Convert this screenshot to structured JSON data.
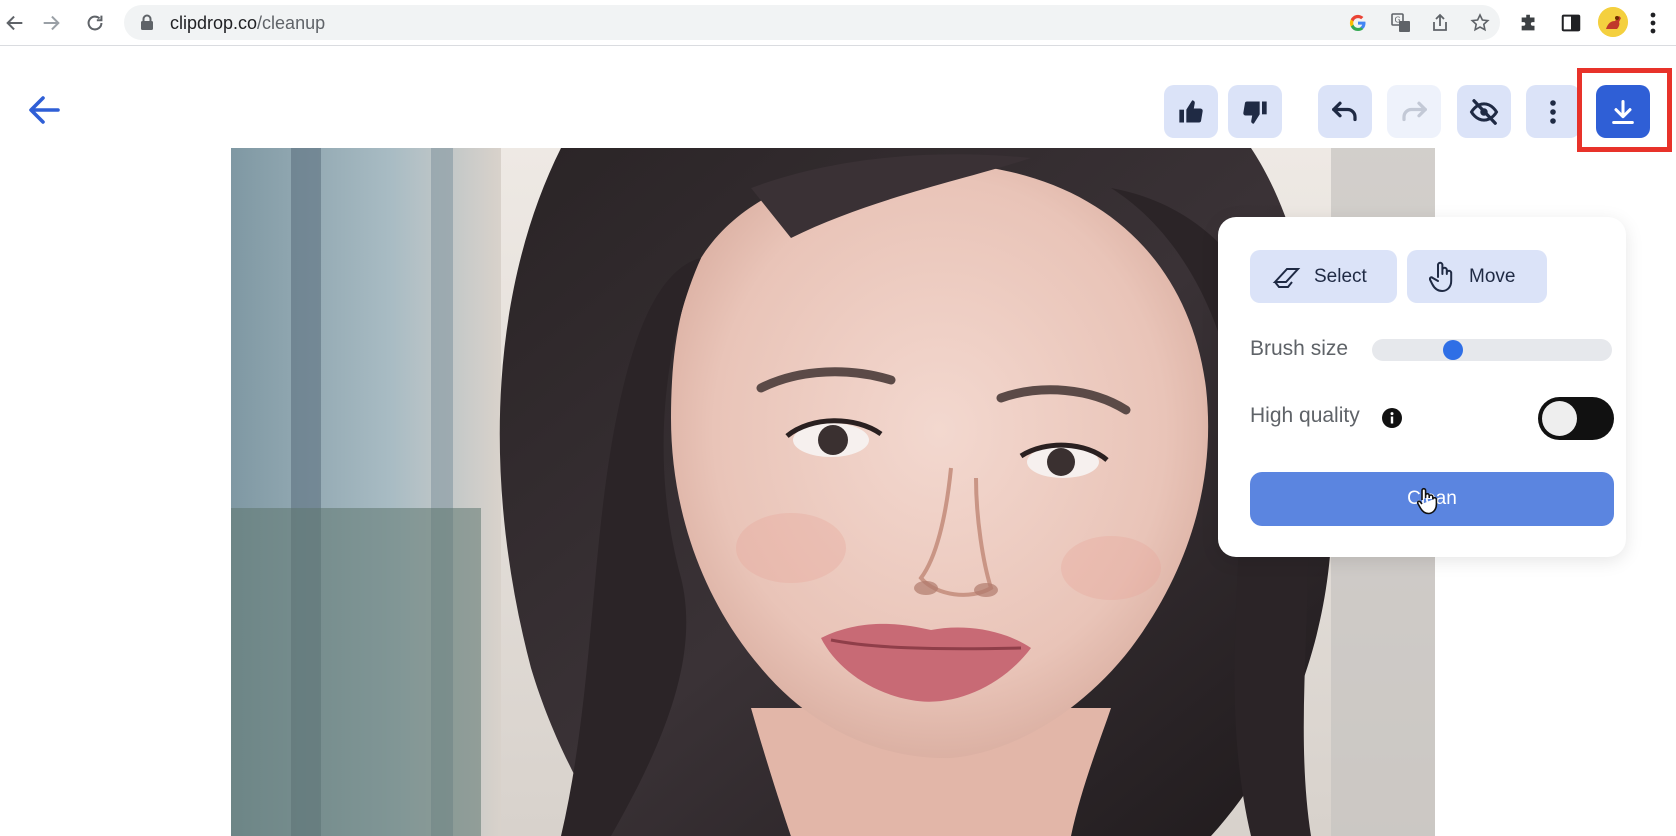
{
  "browser": {
    "url_host": "clipdrop.co",
    "url_path": "/cleanup"
  },
  "toolbar": {
    "buttons": [
      {
        "name": "like",
        "icon": "thumbs-up-icon"
      },
      {
        "name": "dislike",
        "icon": "thumbs-down-icon"
      },
      {
        "name": "undo",
        "icon": "undo-icon"
      },
      {
        "name": "redo",
        "icon": "redo-icon",
        "disabled": true
      },
      {
        "name": "hide-original",
        "icon": "eye-off-icon"
      },
      {
        "name": "more",
        "icon": "more-vertical-icon"
      },
      {
        "name": "download",
        "icon": "download-icon",
        "highlighted": true
      }
    ],
    "highlight_color": "#e8322a"
  },
  "panel": {
    "select_label": "Select",
    "move_label": "Move",
    "brush_size_label": "Brush size",
    "brush_size_value": 0.32,
    "high_quality_label": "High quality",
    "high_quality_enabled": false,
    "clean_label": "Clean"
  },
  "colors": {
    "accent": "#2f5fd6",
    "button_bg": "#dbe3f8",
    "clean_button": "#5b85e0"
  }
}
